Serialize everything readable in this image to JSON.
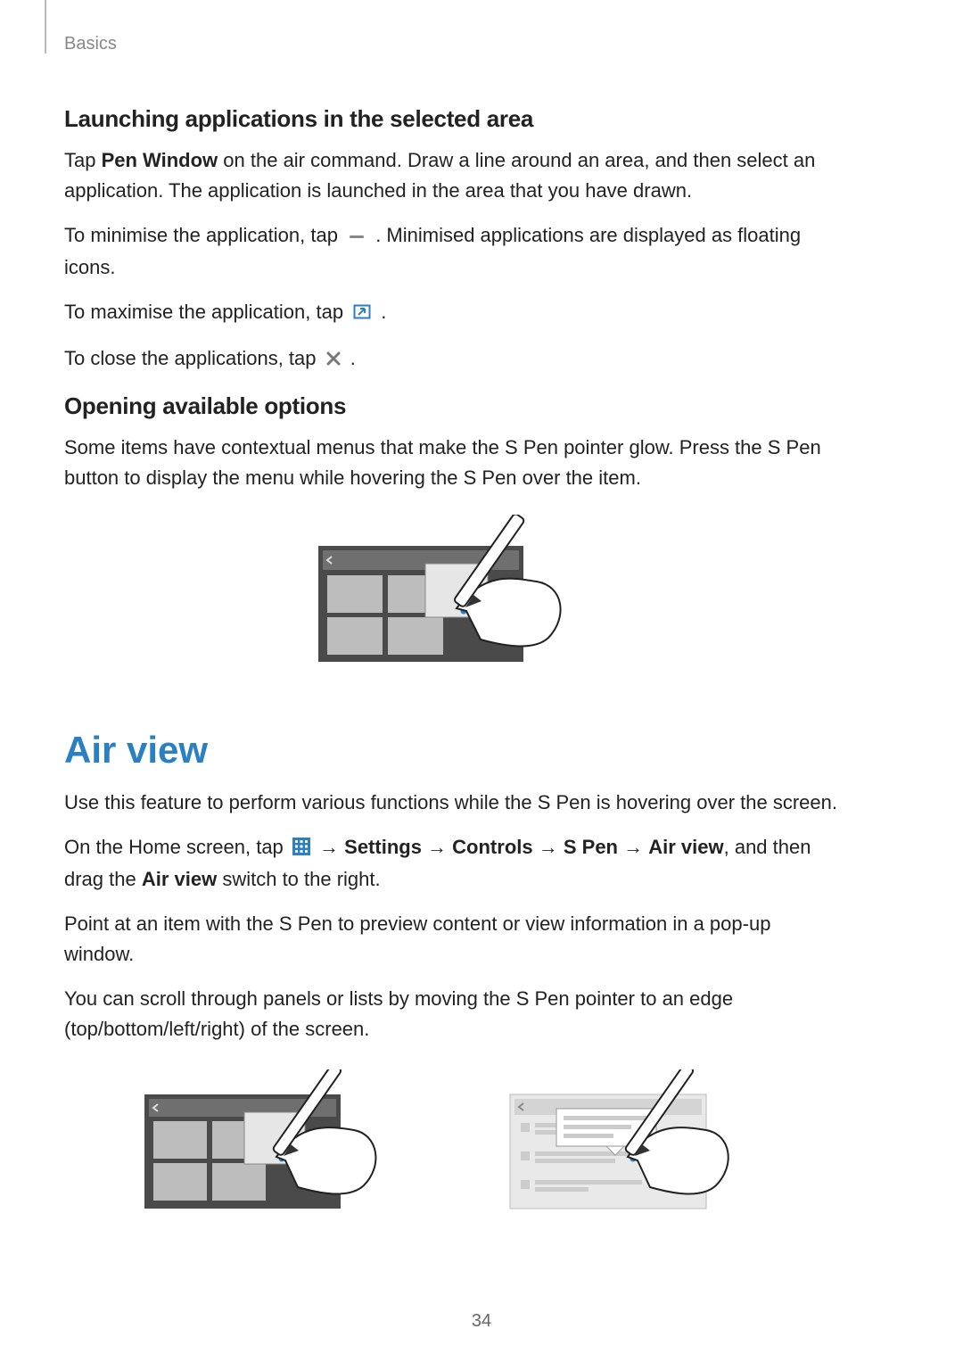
{
  "header": {
    "section": "Basics"
  },
  "footer": {
    "page": "34"
  },
  "sec1": {
    "heading": "Launching applications in the selected area",
    "p1_a": "Tap ",
    "p1_bold": "Pen Window",
    "p1_b": " on the air command. Draw a line around an area, and then select an application. The application is launched in the area that you have drawn.",
    "p2_a": "To minimise the application, tap ",
    "p2_b": ". Minimised applications are displayed as floating icons.",
    "p3_a": "To maximise the application, tap ",
    "p3_b": ".",
    "p4_a": "To close the applications, tap ",
    "p4_b": "."
  },
  "sec2": {
    "heading": "Opening available options",
    "p1": "Some items have contextual menus that make the S Pen pointer glow. Press the S Pen button to display the menu while hovering the S Pen over the item."
  },
  "air": {
    "heading": "Air view",
    "p1": "Use this feature to perform various functions while the S Pen is hovering over the screen.",
    "p2_a": "On the Home screen, tap ",
    "p2_b1": "Settings",
    "p2_b2": "Controls",
    "p2_b3": "S Pen",
    "p2_b4": "Air view",
    "p2_c": ", and then drag the ",
    "p2_bold": "Air view",
    "p2_d": " switch to the right.",
    "p3": "Point at an item with the S Pen to preview content or view information in a pop-up window.",
    "p4": "You can scroll through panels or lists by moving the S Pen pointer to an edge (top/bottom/left/right) of the screen."
  }
}
